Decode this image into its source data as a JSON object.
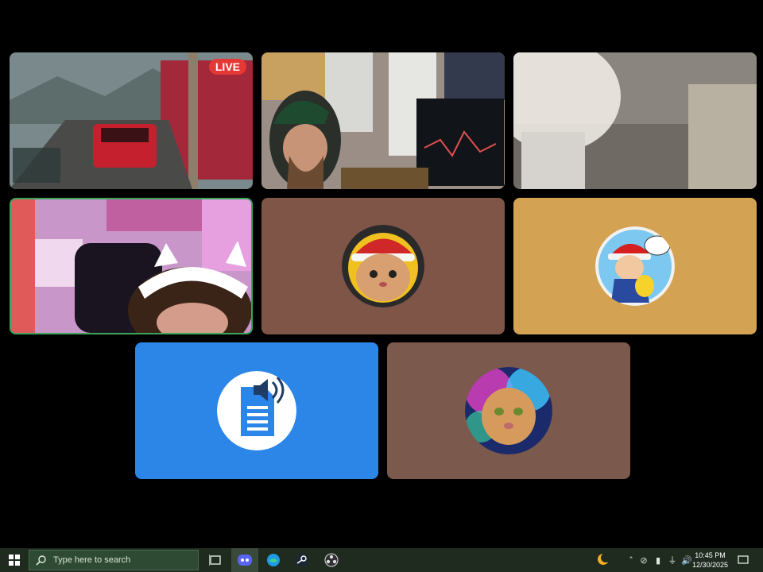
{
  "stream_tile": {
    "live_label": "LIVE"
  },
  "taskbar": {
    "search_placeholder": "Type here to search",
    "time": "10:45 PM",
    "date": "12/30/2025"
  },
  "colors": {
    "tile_brown": "#7f5548",
    "tile_tan": "#d4a253",
    "tile_blue": "#2c86e8",
    "tile_brown2": "#7b594c",
    "speaking_border": "#3ba55c"
  }
}
